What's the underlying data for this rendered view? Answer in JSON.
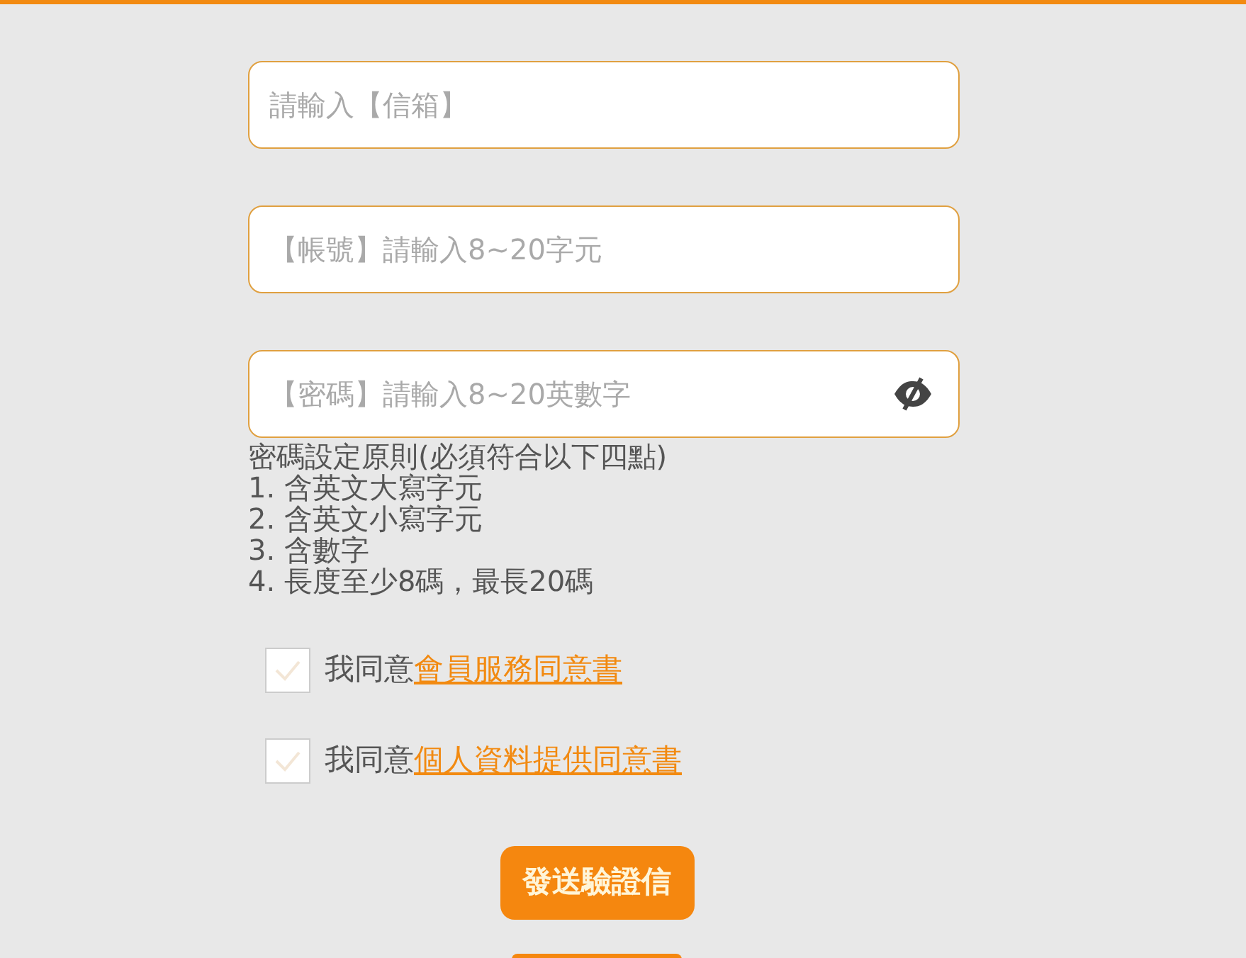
{
  "fields": [
    {
      "placeholder": "請輸入【信箱】",
      "kind": "text"
    },
    {
      "placeholder": "【帳號】請輸入8~20字元",
      "kind": "text"
    },
    {
      "placeholder": "【密碼】請輸入8~20英數字",
      "kind": "password"
    }
  ],
  "password_rules": {
    "title": "密碼設定原則(必須符合以下四點)",
    "items": [
      "1. 含英文大寫字元",
      "2. 含英文小寫字元",
      "3. 含數字",
      "4. 長度至少8碼，最長20碼"
    ]
  },
  "agreements": [
    {
      "text": "我同意",
      "link": "會員服務同意書",
      "checked": false
    },
    {
      "text": "我同意",
      "link": "個人資料提供同意書",
      "checked": false
    }
  ],
  "submit_button": "發送驗證信"
}
